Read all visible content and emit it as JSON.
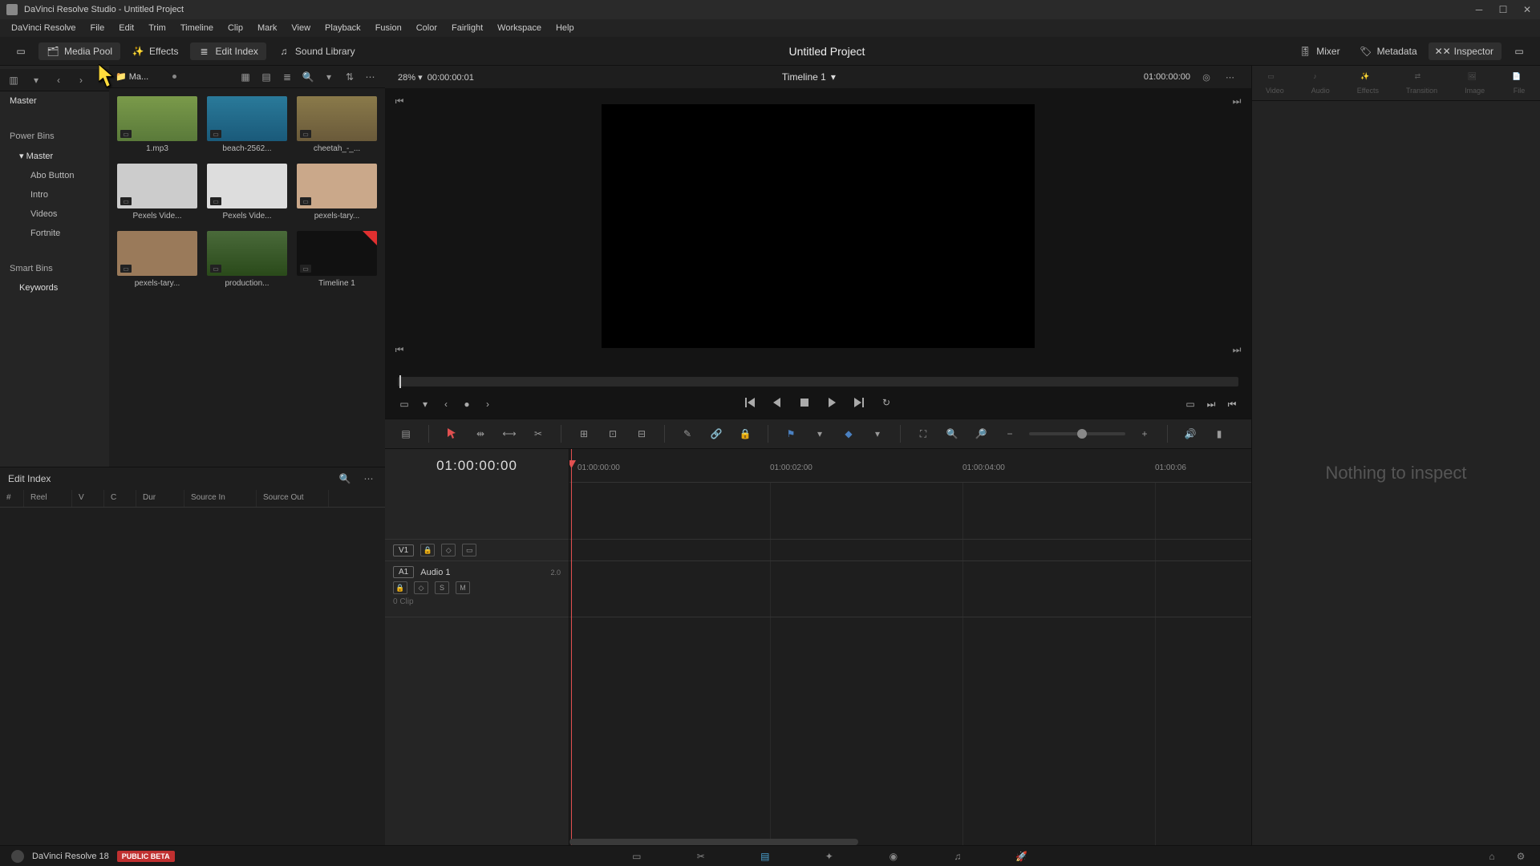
{
  "titlebar": {
    "text": "DaVinci Resolve Studio - Untitled Project"
  },
  "menubar": [
    "DaVinci Resolve",
    "File",
    "Edit",
    "Trim",
    "Timeline",
    "Clip",
    "Mark",
    "View",
    "Playback",
    "Fusion",
    "Color",
    "Fairlight",
    "Workspace",
    "Help"
  ],
  "panelbar": {
    "left": [
      {
        "label": "Media Pool",
        "active": true
      },
      {
        "label": "Effects",
        "active": false
      },
      {
        "label": "Edit Index",
        "active": true
      },
      {
        "label": "Sound Library",
        "active": false
      }
    ],
    "title": "Untitled Project",
    "right": [
      {
        "label": "Mixer",
        "active": false
      },
      {
        "label": "Metadata",
        "active": false
      },
      {
        "label": "Inspector",
        "active": true
      }
    ]
  },
  "mediaHeader": {
    "crumb": "Ma..."
  },
  "bins": {
    "master": "Master",
    "powerHeader": "Power Bins",
    "powerMaster": "Master",
    "children": [
      "Abo Button",
      "Intro",
      "Videos",
      "Fortnite"
    ],
    "smartHeader": "Smart Bins",
    "smart": [
      "Keywords"
    ]
  },
  "clips": [
    {
      "name": "1.mp3",
      "cls": "audio"
    },
    {
      "name": "beach-2562...",
      "cls": "beach"
    },
    {
      "name": "cheetah_-_...",
      "cls": "cheetah"
    },
    {
      "name": "Pexels Vide...",
      "cls": "pexels1"
    },
    {
      "name": "Pexels Vide...",
      "cls": "pexels2"
    },
    {
      "name": "pexels-tary...",
      "cls": "tary"
    },
    {
      "name": "pexels-tary...",
      "cls": "tary2"
    },
    {
      "name": "production...",
      "cls": "prod"
    },
    {
      "name": "Timeline 1",
      "cls": "tl"
    }
  ],
  "editIndex": {
    "title": "Edit Index",
    "cols": [
      "#",
      "Reel",
      "V",
      "C",
      "Dur",
      "Source In",
      "Source Out"
    ]
  },
  "viewer": {
    "zoom": "28%",
    "srcTC": "00:00:00:01",
    "name": "Timeline 1",
    "recTC": "01:00:00:00"
  },
  "timeline": {
    "tc": "01:00:00:00",
    "ruler": [
      "01:00:00:00",
      "01:00:02:00",
      "01:00:04:00",
      "01:00:06"
    ],
    "v1": "V1",
    "a1": "A1",
    "a1name": "Audio 1",
    "a1ch": "2.0",
    "a1clip": "0 Clip",
    "s": "S",
    "m": "M"
  },
  "inspector": {
    "tabs": [
      "Video",
      "Audio",
      "Effects",
      "Transition",
      "Image",
      "File"
    ],
    "empty": "Nothing to inspect"
  },
  "bottom": {
    "app": "DaVinci Resolve 18",
    "badge": "PUBLIC BETA"
  }
}
